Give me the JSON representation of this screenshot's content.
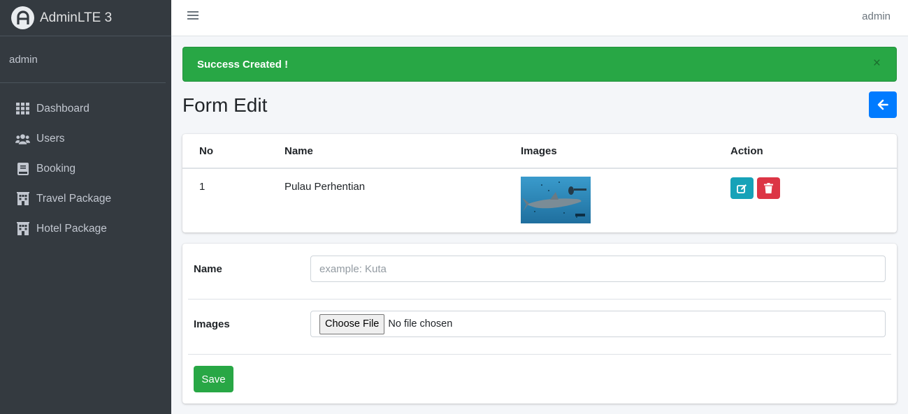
{
  "brand": {
    "title": "AdminLTE 3",
    "logo_icon": "adminlte-logo-icon"
  },
  "sidebar": {
    "user": "admin",
    "items": [
      {
        "label": "Dashboard",
        "icon": "grid-icon"
      },
      {
        "label": "Users",
        "icon": "users-icon"
      },
      {
        "label": "Booking",
        "icon": "book-icon"
      },
      {
        "label": "Travel Package",
        "icon": "building-icon"
      },
      {
        "label": "Hotel Package",
        "icon": "building-icon"
      }
    ]
  },
  "topbar": {
    "menu_icon": "hamburger-icon",
    "user": "admin"
  },
  "alert": {
    "message": "Success Created !",
    "close": "×",
    "color": "#28a745"
  },
  "page": {
    "title": "Form Edit",
    "back_icon": "arrow-left-icon"
  },
  "table": {
    "headers": [
      "No",
      "Name",
      "Images",
      "Action"
    ],
    "rows": [
      {
        "no": "1",
        "name": "Pulau Perhentian",
        "image": "shark-underwater-thumbnail",
        "actions": [
          "edit-icon",
          "trash-icon"
        ]
      }
    ]
  },
  "form": {
    "name_label": "Name",
    "name_placeholder": "example: Kuta",
    "images_label": "Images",
    "file_button": "Choose File",
    "file_status": "No file chosen",
    "save_label": "Save"
  },
  "colors": {
    "sidebar": "#343a40",
    "primary": "#007bff",
    "success": "#28a745",
    "info": "#17a2b8",
    "danger": "#dc3545"
  }
}
